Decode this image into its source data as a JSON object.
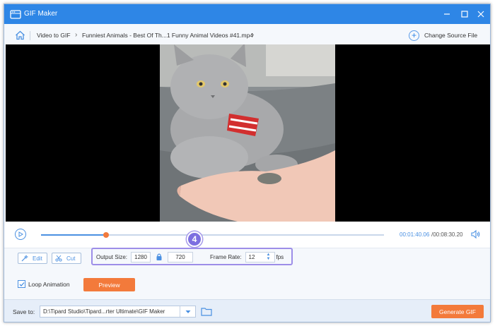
{
  "window": {
    "title": "GIF Maker",
    "accent_color": "#2e86e6",
    "controls": [
      "minimize-icon",
      "maximize-icon",
      "close-icon"
    ]
  },
  "breadcrumb": {
    "home_icon": "home-icon",
    "items": [
      "Video to GIF",
      "Funniest Animals - Best Of Th...1 Funny Animal Videos #41.mp4"
    ],
    "change_source_label": "Change Source File"
  },
  "player": {
    "play_icon": "play-icon",
    "progress_fraction": 0.19,
    "current_time": "00:01:40.06",
    "total_time": "/00:08:30.20",
    "volume_icon": "volume-icon"
  },
  "tools": {
    "edit_label": "Edit",
    "cut_label": "Cut"
  },
  "step_badge": "4",
  "output": {
    "size_label": "Output Size:",
    "width": "1280",
    "height": "720",
    "frame_rate_label": "Frame Rate:",
    "frame_rate": "12",
    "fps_label": "fps"
  },
  "loop": {
    "label": "Loop Animation",
    "checked": true
  },
  "preview_label": "Preview",
  "save": {
    "label": "Save to:",
    "path": "D:\\Tipard Studio\\Tipard...rter Ultimate\\GIF Maker"
  },
  "generate_label": "Generate GIF",
  "button_color": "#f37a3b"
}
